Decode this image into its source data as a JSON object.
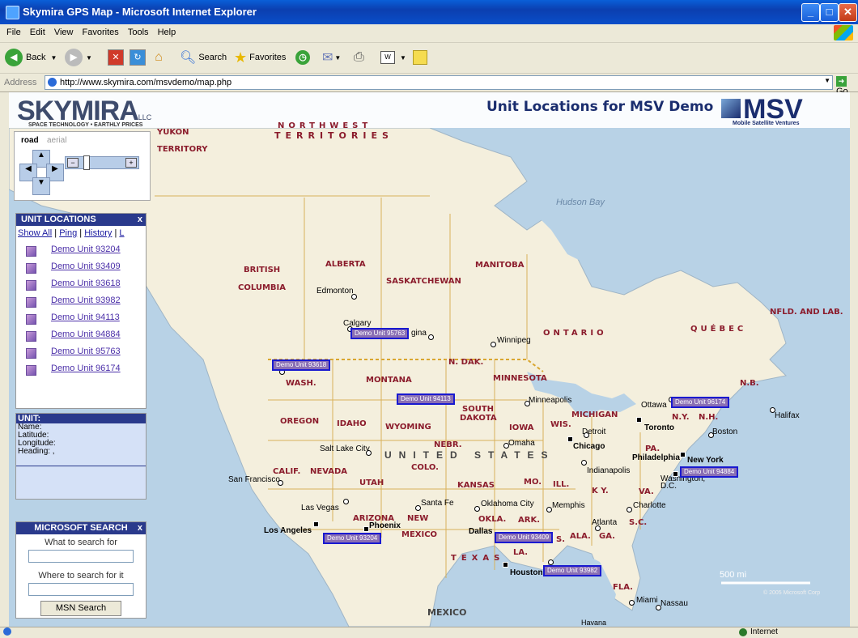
{
  "window": {
    "title": "Skymira GPS Map - Microsoft Internet Explorer"
  },
  "menu": [
    "File",
    "Edit",
    "View",
    "Favorites",
    "Tools",
    "Help"
  ],
  "toolbar": {
    "back": "Back",
    "search": "Search",
    "favorites": "Favorites"
  },
  "address": {
    "label": "Address",
    "url": "http://www.skymira.com/msvdemo/map.php",
    "go": "Go"
  },
  "header": {
    "logo": "SKYMIRA",
    "logo_suffix": "LLC",
    "tagline": "SPACE TECHNOLOGY • EARTHLY PRICES",
    "page_title": "Unit Locations for MSV Demo",
    "partner_logo": "MSV",
    "partner_name": "Mobile Satellite Ventures"
  },
  "map_controls": {
    "road": "road",
    "aerial": "aerial"
  },
  "unit_panel": {
    "title": "UNIT LOCATIONS",
    "close": "x",
    "tabs": [
      "Show All",
      "Ping",
      "History",
      "L"
    ],
    "units": [
      "Demo Unit 93204",
      "Demo Unit 93409",
      "Demo Unit 93618",
      "Demo Unit 93982",
      "Demo Unit 94113",
      "Demo Unit 94884",
      "Demo Unit 95763",
      "Demo Unit 96174"
    ]
  },
  "info_panel": {
    "title": "UNIT:",
    "fields": [
      "Name:",
      "Latitude:",
      "Longitude:",
      "Heading: ,"
    ]
  },
  "search_panel": {
    "title": "MICROSOFT SEARCH",
    "close": "x",
    "what_label": "What to search for",
    "where_label": "Where to search for it",
    "button": "MSN Search"
  },
  "map": {
    "regions": [
      "YUKON",
      "TERRITORY",
      "NORTHWEST",
      "TERRITORIES",
      "ALBERTA",
      "BRITISH",
      "COLUMBIA",
      "SASKATCHEWAN",
      "MANITOBA",
      "ONTARIO",
      "QUÉBEC",
      "NFLD. AND LAB.",
      "N.B.",
      "WASH.",
      "MONTANA",
      "N. DAK.",
      "MINNESOTA",
      "SOUTH",
      "DAKOTA",
      "OREGON",
      "IDAHO",
      "WYOMING",
      "IOWA",
      "WIS.",
      "MICHIGAN",
      "N.Y.",
      "N.H.",
      "NEBR.",
      "PA.",
      "CALIF.",
      "NEVADA",
      "COLO.",
      "UTAH",
      "KANSAS",
      "MO.",
      "ILL.",
      "K Y.",
      "VA.",
      "ARIZONA",
      "NEW",
      "MEXICO",
      "OKLA.",
      "ARK.",
      "S.C.",
      "ALA.",
      "GA.",
      "S.",
      "LA.",
      "TEXAS",
      "FLA.",
      "MEXICO",
      "UNITED STATES"
    ],
    "cities": [
      "Edmonton",
      "Calgary",
      "gina",
      "Winnipeg",
      "Minneapolis",
      "Ottawa",
      "Toronto",
      "Halifax",
      "Boston",
      "New York",
      "Philadelphia",
      "Washington, D.C.",
      "Detroit",
      "Chicago",
      "Omaha",
      "Salt Lake City",
      "Indianapolis",
      "San Francisco",
      "Las Vegas",
      "Los Angeles",
      "Phoenix",
      "Santa Fe",
      "Oklahoma City",
      "Memphis",
      "Atlanta",
      "Charlotte",
      "Dallas",
      "Houston",
      "Miami",
      "Nassau",
      "Havana"
    ],
    "water": "Hudson Bay",
    "scale": "500 mi",
    "copyright": "© 2005 Microsoft Corp",
    "unit_markers": [
      "Demo Unit 95763",
      "Demo Unit 93618",
      "Demo Unit 94113",
      "Demo Unit 96174",
      "Demo Unit 94884",
      "Demo Unit 93204",
      "Demo Unit 93409",
      "Demo Unit 93982"
    ]
  },
  "status": {
    "zone": "Internet"
  }
}
